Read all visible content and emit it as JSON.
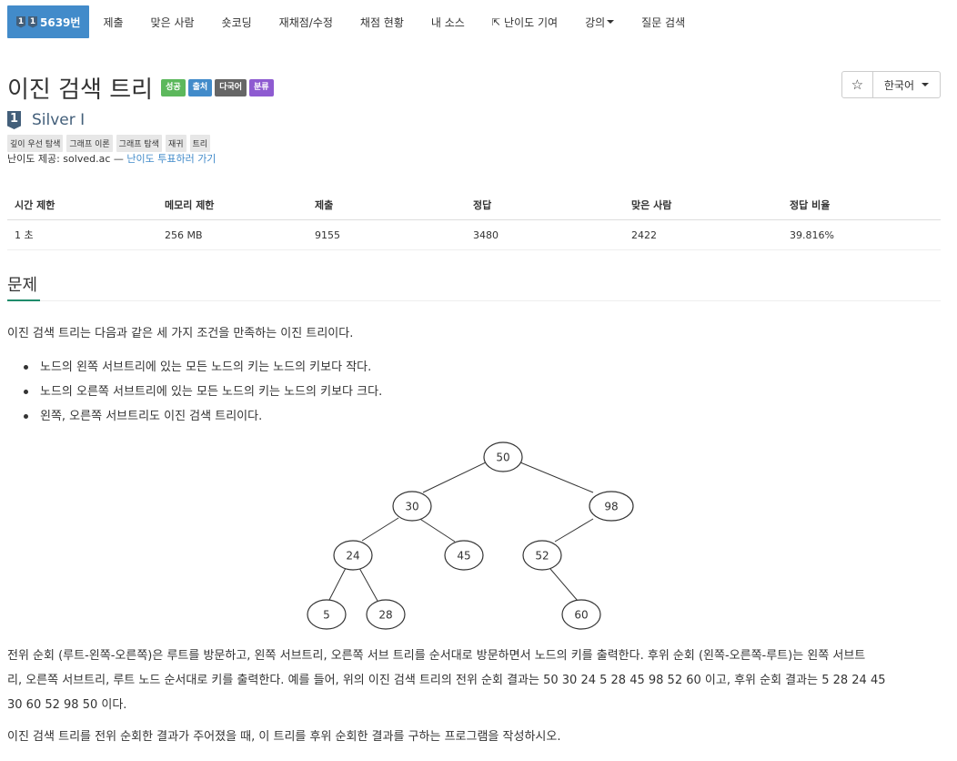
{
  "nav": {
    "problem_number": "5639번",
    "items": [
      "제출",
      "맞은 사람",
      "숏코딩",
      "재채점/수정",
      "채점 현황",
      "내 소스",
      "난이도 기여",
      "강의",
      "질문 검색"
    ]
  },
  "problem": {
    "title": "이진 검색 트리",
    "labels": [
      "성공",
      "출처",
      "다국어",
      "분류"
    ],
    "tier_number": "1",
    "tier_name": "Silver I",
    "tags": [
      "깊이 우선 탐색",
      "그래프 이론",
      "그래프 탐색",
      "재귀",
      "트리"
    ],
    "difficulty_prefix": "난이도 제공: solved.ac — ",
    "difficulty_link": "난이도 투표하러 가기"
  },
  "controls": {
    "star_icon": "star-icon",
    "language": "한국어"
  },
  "stats": {
    "headers": [
      "시간 제한",
      "메모리 제한",
      "제출",
      "정답",
      "맞은 사람",
      "정답 비율"
    ],
    "values": [
      "1 초",
      "256 MB",
      "9155",
      "3480",
      "2422",
      "39.816%"
    ]
  },
  "section": {
    "title": "문제"
  },
  "description": {
    "intro": "이진 검색 트리는 다음과 같은 세 가지 조건을 만족하는 이진 트리이다.",
    "conditions": [
      "노드의 왼쪽 서브트리에 있는 모든 노드의 키는 노드의 키보다 작다.",
      "노드의 오른쪽 서브트리에 있는 모든 노드의 키는 노드의 키보다 크다.",
      "왼쪽, 오른쪽 서브트리도 이진 검색 트리이다."
    ],
    "traversal_line1": "전위 순회 (루트-왼쪽-오른쪽)은 루트를 방문하고, 왼쪽 서브트리, 오른쪽 서브 트리를 순서대로 방문하면서 노드의 키를 출력한다. 후위 순회 (왼쪽-오른쪽-루트)는 왼쪽 서브트",
    "traversal_line2": "리, 오른쪽 서브트리, 루트 노드 순서대로 키를 출력한다. 예를 들어, 위의 이진 검색 트리의 전위 순회 결과는 50 30 24 5 28 45 98 52 60 이고, 후위 순회 결과는 5 28 24 45",
    "traversal_line3": "30 60 52 98 50 이다.",
    "task": "이진 검색 트리를 전위 순회한 결과가 주어졌을 때, 이 트리를 후위 순회한 결과를 구하는 프로그램을 작성하시오."
  },
  "tree": {
    "nodes": [
      "50",
      "30",
      "98",
      "24",
      "45",
      "52",
      "5",
      "28",
      "60"
    ]
  }
}
